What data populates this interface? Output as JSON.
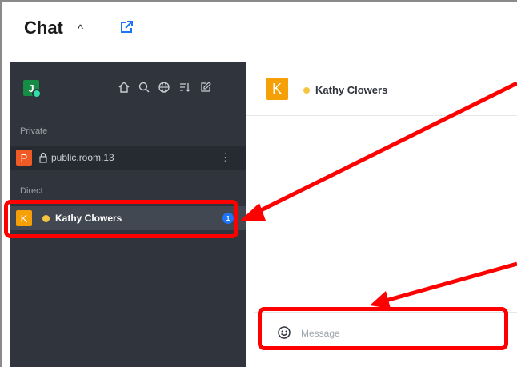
{
  "header": {
    "title": "Chat"
  },
  "sidebar": {
    "user_avatar": "J",
    "icons": [
      "home-icon",
      "search-icon",
      "directory-icon",
      "sort-icon",
      "create-new-icon"
    ],
    "sections": {
      "private": {
        "label": "Private",
        "rooms": [
          {
            "avatar": "P",
            "name": "public.room.13"
          }
        ]
      },
      "direct": {
        "label": "Direct",
        "rooms": [
          {
            "avatar": "K",
            "name": "Kathy Clowers",
            "unread": "1"
          }
        ]
      }
    }
  },
  "room": {
    "avatar": "K",
    "name": "Kathy Clowers"
  },
  "composer": {
    "placeholder": "Message"
  },
  "colors": {
    "sidebar_bg": "#2f343d",
    "highlight": "#ff0000",
    "accent": "#1d74f5",
    "away": "#f5c542"
  }
}
